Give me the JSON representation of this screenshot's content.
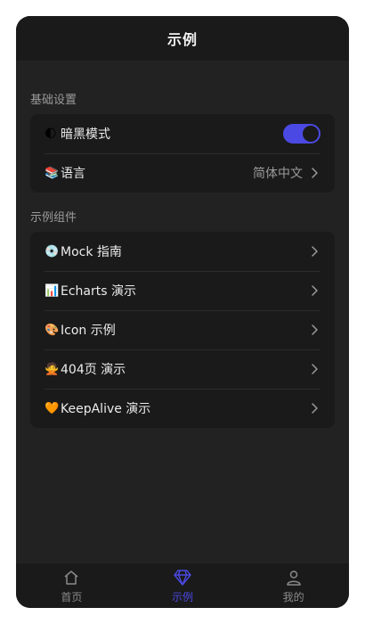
{
  "navbar": {
    "title": "示例"
  },
  "sections": {
    "basic": {
      "title": "基础设置",
      "dark_mode": {
        "emoji": "🌓",
        "label": "暗黑模式",
        "enabled": true
      },
      "language": {
        "emoji": "📚",
        "label": "语言",
        "value": "简体中文"
      }
    },
    "examples": {
      "title": "示例组件",
      "items": [
        {
          "emoji": "💿",
          "label": "Mock 指南"
        },
        {
          "emoji": "📊",
          "label": "Echarts 演示"
        },
        {
          "emoji": "🎨",
          "label": "Icon 示例"
        },
        {
          "emoji": "🙅",
          "label": "404页 演示"
        },
        {
          "emoji": "🧡",
          "label": "KeepAlive 演示"
        }
      ]
    }
  },
  "tabbar": {
    "tabs": [
      {
        "label": "首页",
        "icon": "home-icon",
        "active": false
      },
      {
        "label": "示例",
        "icon": "diamond-icon",
        "active": true
      },
      {
        "label": "我的",
        "icon": "user-icon",
        "active": false
      }
    ]
  },
  "colors": {
    "accent": "#4b49e3",
    "background": "#222222",
    "card": "#1a1a1a"
  }
}
